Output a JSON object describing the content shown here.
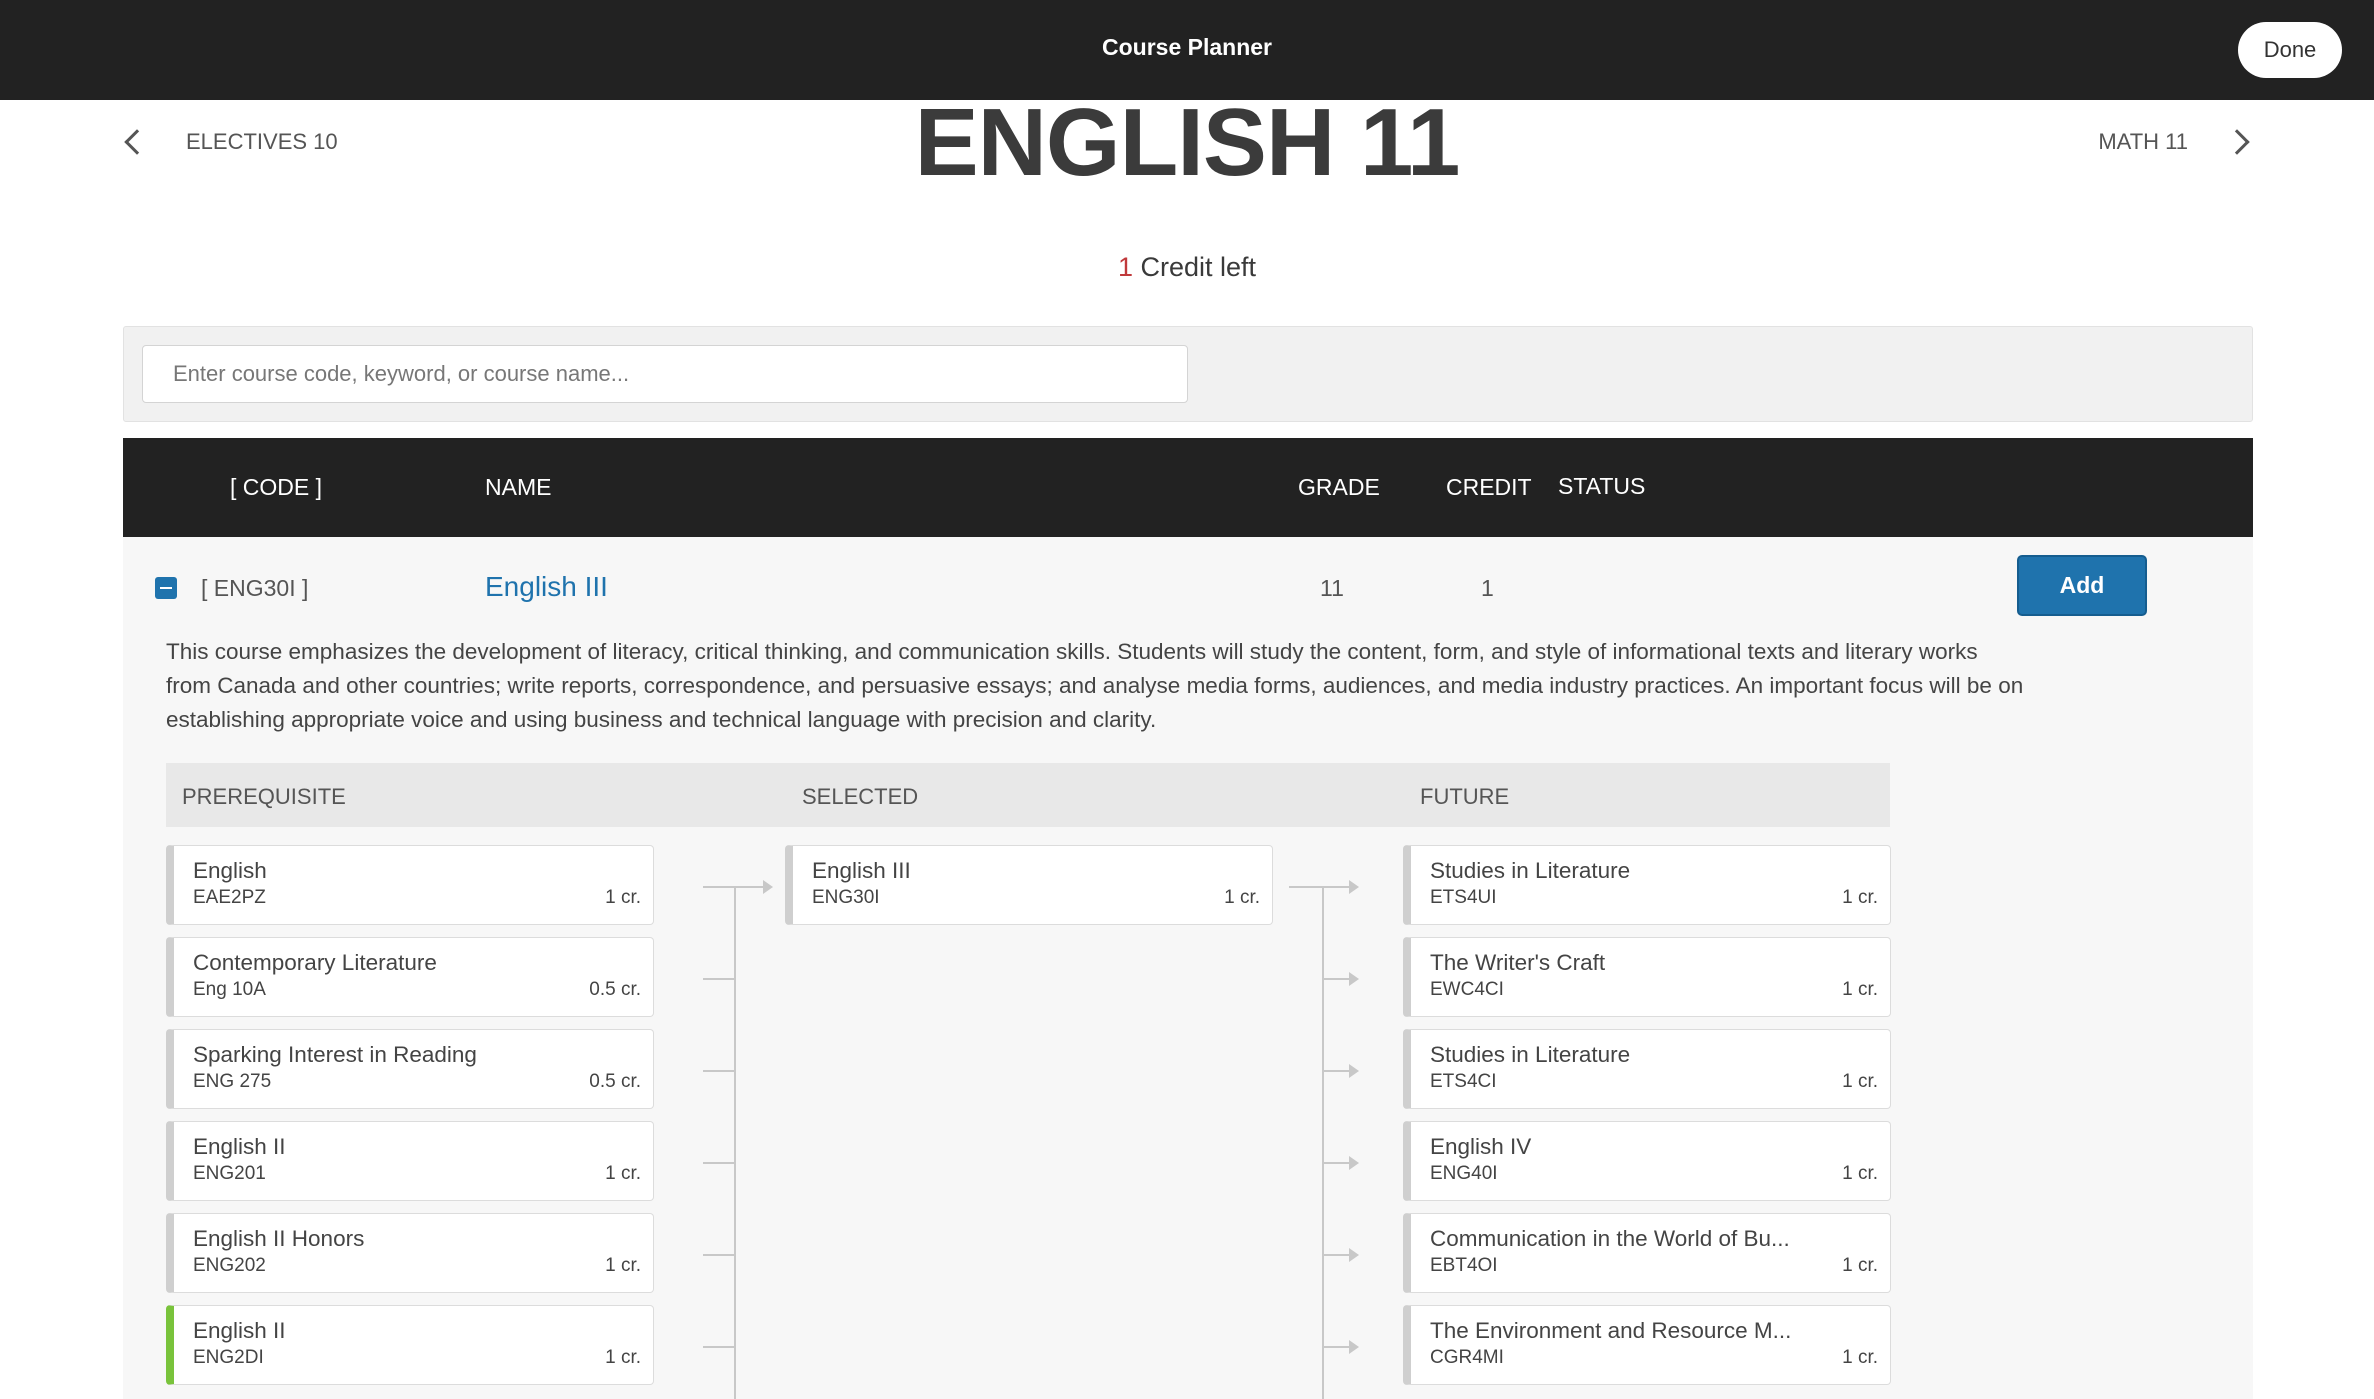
{
  "topbar": {
    "title": "Course Planner",
    "done_label": "Done"
  },
  "nav": {
    "prev_label": "ELECTIVES 10",
    "next_label": "MATH 11"
  },
  "page_title": "ENGLISH 11",
  "credits": {
    "count": "1",
    "label": " Credit left"
  },
  "search": {
    "placeholder": "Enter course code, keyword, or course name...",
    "value": ""
  },
  "table": {
    "headers": {
      "code": "[ CODE ]",
      "name": "NAME",
      "grade": "GRADE",
      "credit": "CREDIT",
      "status": "STATUS"
    }
  },
  "course": {
    "code": "[ ENG30I ]",
    "name": "English III",
    "grade": "11",
    "credit": "1",
    "add_label": "Add",
    "description": "This course emphasizes the development of literacy, critical thinking, and communication skills. Students will study the content, form, and style of informational texts and literary works from Canada and other countries; write reports, correspondence, and persuasive essays; and analyse media forms, audiences, and media industry practices. An important focus will be on establishing appropriate voice and using business and technical language with precision and clarity."
  },
  "pathway": {
    "headers": {
      "prerequisite": "PREREQUISITE",
      "selected": "SELECTED",
      "future": "FUTURE"
    },
    "prerequisites": [
      {
        "name": "English",
        "code": "EAE2PZ",
        "credit": "1 cr."
      },
      {
        "name": "Contemporary Literature",
        "code": "Eng 10A",
        "credit": "0.5 cr."
      },
      {
        "name": "Sparking Interest in Reading",
        "code": "ENG 275",
        "credit": "0.5 cr."
      },
      {
        "name": "English II",
        "code": "ENG201",
        "credit": "1 cr."
      },
      {
        "name": "English II Honors",
        "code": "ENG202",
        "credit": "1 cr."
      },
      {
        "name": "English II",
        "code": "ENG2DI",
        "credit": "1 cr."
      }
    ],
    "selected": [
      {
        "name": "English III",
        "code": "ENG30I",
        "credit": "1 cr."
      }
    ],
    "future": [
      {
        "name": "Studies in Literature",
        "code": "ETS4UI",
        "credit": "1 cr."
      },
      {
        "name": "The Writer's Craft",
        "code": "EWC4CI",
        "credit": "1 cr."
      },
      {
        "name": "Studies in Literature",
        "code": "ETS4CI",
        "credit": "1 cr."
      },
      {
        "name": "English IV",
        "code": "ENG40I",
        "credit": "1 cr."
      },
      {
        "name": "Communication in the World of Bu...",
        "code": "EBT4OI",
        "credit": "1 cr."
      },
      {
        "name": "The Environment and Resource M...",
        "code": "CGR4MI",
        "credit": "1 cr."
      }
    ],
    "colors": {
      "default_bar": "#cfcfcf",
      "completed_bar": "#79c33b"
    },
    "completed_prerequisite_index": 5
  },
  "colors": {
    "accent": "#1f73ad",
    "header_bg": "#222222",
    "credit_count": "#c0393b"
  }
}
